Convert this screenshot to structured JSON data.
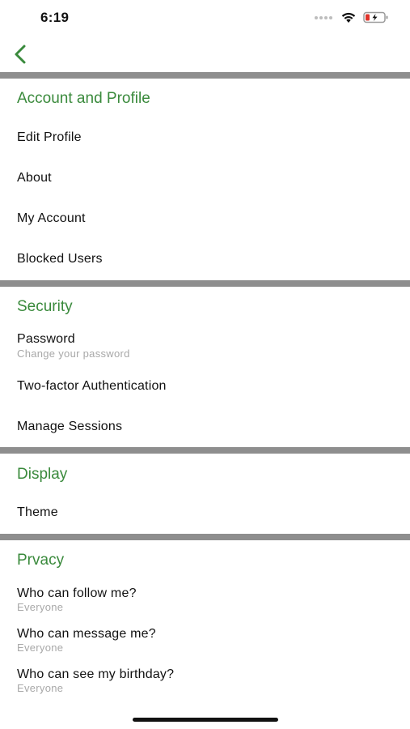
{
  "status_bar": {
    "time": "6:19",
    "icons": [
      "signal-dots-icon",
      "wifi-icon",
      "battery-charging-icon"
    ],
    "battery_color": "#e0342b"
  },
  "nav": {
    "back_icon": "chevron-left-icon",
    "accent_color": "#3a8a3c"
  },
  "sections": {
    "account": {
      "title": "Account and Profile",
      "items": [
        {
          "label": "Edit Profile"
        },
        {
          "label": "About"
        },
        {
          "label": "My Account"
        },
        {
          "label": "Blocked Users"
        }
      ]
    },
    "security": {
      "title": "Security",
      "items": [
        {
          "label": "Password",
          "subtitle": "Change your password"
        },
        {
          "label": "Two-factor Authentication"
        },
        {
          "label": "Manage Sessions"
        }
      ]
    },
    "display": {
      "title": "Display",
      "items": [
        {
          "label": "Theme"
        }
      ]
    },
    "privacy": {
      "title": "Prvacy",
      "items": [
        {
          "label": "Who can follow me?",
          "subtitle": "Everyone"
        },
        {
          "label": "Who can message me?",
          "subtitle": "Everyone"
        },
        {
          "label": "Who can see my birthday?",
          "subtitle": "Everyone"
        }
      ]
    }
  }
}
